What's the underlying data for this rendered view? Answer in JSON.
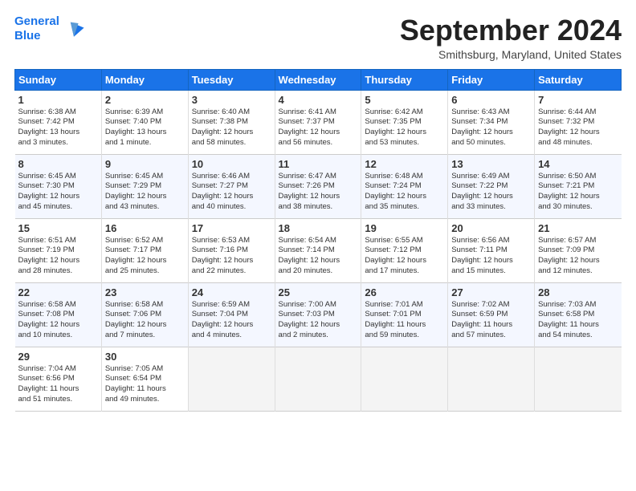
{
  "header": {
    "logo_line1": "General",
    "logo_line2": "Blue",
    "month_title": "September 2024",
    "subtitle": "Smithsburg, Maryland, United States"
  },
  "days_of_week": [
    "Sunday",
    "Monday",
    "Tuesday",
    "Wednesday",
    "Thursday",
    "Friday",
    "Saturday"
  ],
  "weeks": [
    [
      {
        "day": "1",
        "info": "Sunrise: 6:38 AM\nSunset: 7:42 PM\nDaylight: 13 hours\nand 3 minutes."
      },
      {
        "day": "2",
        "info": "Sunrise: 6:39 AM\nSunset: 7:40 PM\nDaylight: 13 hours\nand 1 minute."
      },
      {
        "day": "3",
        "info": "Sunrise: 6:40 AM\nSunset: 7:38 PM\nDaylight: 12 hours\nand 58 minutes."
      },
      {
        "day": "4",
        "info": "Sunrise: 6:41 AM\nSunset: 7:37 PM\nDaylight: 12 hours\nand 56 minutes."
      },
      {
        "day": "5",
        "info": "Sunrise: 6:42 AM\nSunset: 7:35 PM\nDaylight: 12 hours\nand 53 minutes."
      },
      {
        "day": "6",
        "info": "Sunrise: 6:43 AM\nSunset: 7:34 PM\nDaylight: 12 hours\nand 50 minutes."
      },
      {
        "day": "7",
        "info": "Sunrise: 6:44 AM\nSunset: 7:32 PM\nDaylight: 12 hours\nand 48 minutes."
      }
    ],
    [
      {
        "day": "8",
        "info": "Sunrise: 6:45 AM\nSunset: 7:30 PM\nDaylight: 12 hours\nand 45 minutes."
      },
      {
        "day": "9",
        "info": "Sunrise: 6:45 AM\nSunset: 7:29 PM\nDaylight: 12 hours\nand 43 minutes."
      },
      {
        "day": "10",
        "info": "Sunrise: 6:46 AM\nSunset: 7:27 PM\nDaylight: 12 hours\nand 40 minutes."
      },
      {
        "day": "11",
        "info": "Sunrise: 6:47 AM\nSunset: 7:26 PM\nDaylight: 12 hours\nand 38 minutes."
      },
      {
        "day": "12",
        "info": "Sunrise: 6:48 AM\nSunset: 7:24 PM\nDaylight: 12 hours\nand 35 minutes."
      },
      {
        "day": "13",
        "info": "Sunrise: 6:49 AM\nSunset: 7:22 PM\nDaylight: 12 hours\nand 33 minutes."
      },
      {
        "day": "14",
        "info": "Sunrise: 6:50 AM\nSunset: 7:21 PM\nDaylight: 12 hours\nand 30 minutes."
      }
    ],
    [
      {
        "day": "15",
        "info": "Sunrise: 6:51 AM\nSunset: 7:19 PM\nDaylight: 12 hours\nand 28 minutes."
      },
      {
        "day": "16",
        "info": "Sunrise: 6:52 AM\nSunset: 7:17 PM\nDaylight: 12 hours\nand 25 minutes."
      },
      {
        "day": "17",
        "info": "Sunrise: 6:53 AM\nSunset: 7:16 PM\nDaylight: 12 hours\nand 22 minutes."
      },
      {
        "day": "18",
        "info": "Sunrise: 6:54 AM\nSunset: 7:14 PM\nDaylight: 12 hours\nand 20 minutes."
      },
      {
        "day": "19",
        "info": "Sunrise: 6:55 AM\nSunset: 7:12 PM\nDaylight: 12 hours\nand 17 minutes."
      },
      {
        "day": "20",
        "info": "Sunrise: 6:56 AM\nSunset: 7:11 PM\nDaylight: 12 hours\nand 15 minutes."
      },
      {
        "day": "21",
        "info": "Sunrise: 6:57 AM\nSunset: 7:09 PM\nDaylight: 12 hours\nand 12 minutes."
      }
    ],
    [
      {
        "day": "22",
        "info": "Sunrise: 6:58 AM\nSunset: 7:08 PM\nDaylight: 12 hours\nand 10 minutes."
      },
      {
        "day": "23",
        "info": "Sunrise: 6:58 AM\nSunset: 7:06 PM\nDaylight: 12 hours\nand 7 minutes."
      },
      {
        "day": "24",
        "info": "Sunrise: 6:59 AM\nSunset: 7:04 PM\nDaylight: 12 hours\nand 4 minutes."
      },
      {
        "day": "25",
        "info": "Sunrise: 7:00 AM\nSunset: 7:03 PM\nDaylight: 12 hours\nand 2 minutes."
      },
      {
        "day": "26",
        "info": "Sunrise: 7:01 AM\nSunset: 7:01 PM\nDaylight: 11 hours\nand 59 minutes."
      },
      {
        "day": "27",
        "info": "Sunrise: 7:02 AM\nSunset: 6:59 PM\nDaylight: 11 hours\nand 57 minutes."
      },
      {
        "day": "28",
        "info": "Sunrise: 7:03 AM\nSunset: 6:58 PM\nDaylight: 11 hours\nand 54 minutes."
      }
    ],
    [
      {
        "day": "29",
        "info": "Sunrise: 7:04 AM\nSunset: 6:56 PM\nDaylight: 11 hours\nand 51 minutes."
      },
      {
        "day": "30",
        "info": "Sunrise: 7:05 AM\nSunset: 6:54 PM\nDaylight: 11 hours\nand 49 minutes."
      },
      {
        "day": "",
        "info": ""
      },
      {
        "day": "",
        "info": ""
      },
      {
        "day": "",
        "info": ""
      },
      {
        "day": "",
        "info": ""
      },
      {
        "day": "",
        "info": ""
      }
    ]
  ]
}
